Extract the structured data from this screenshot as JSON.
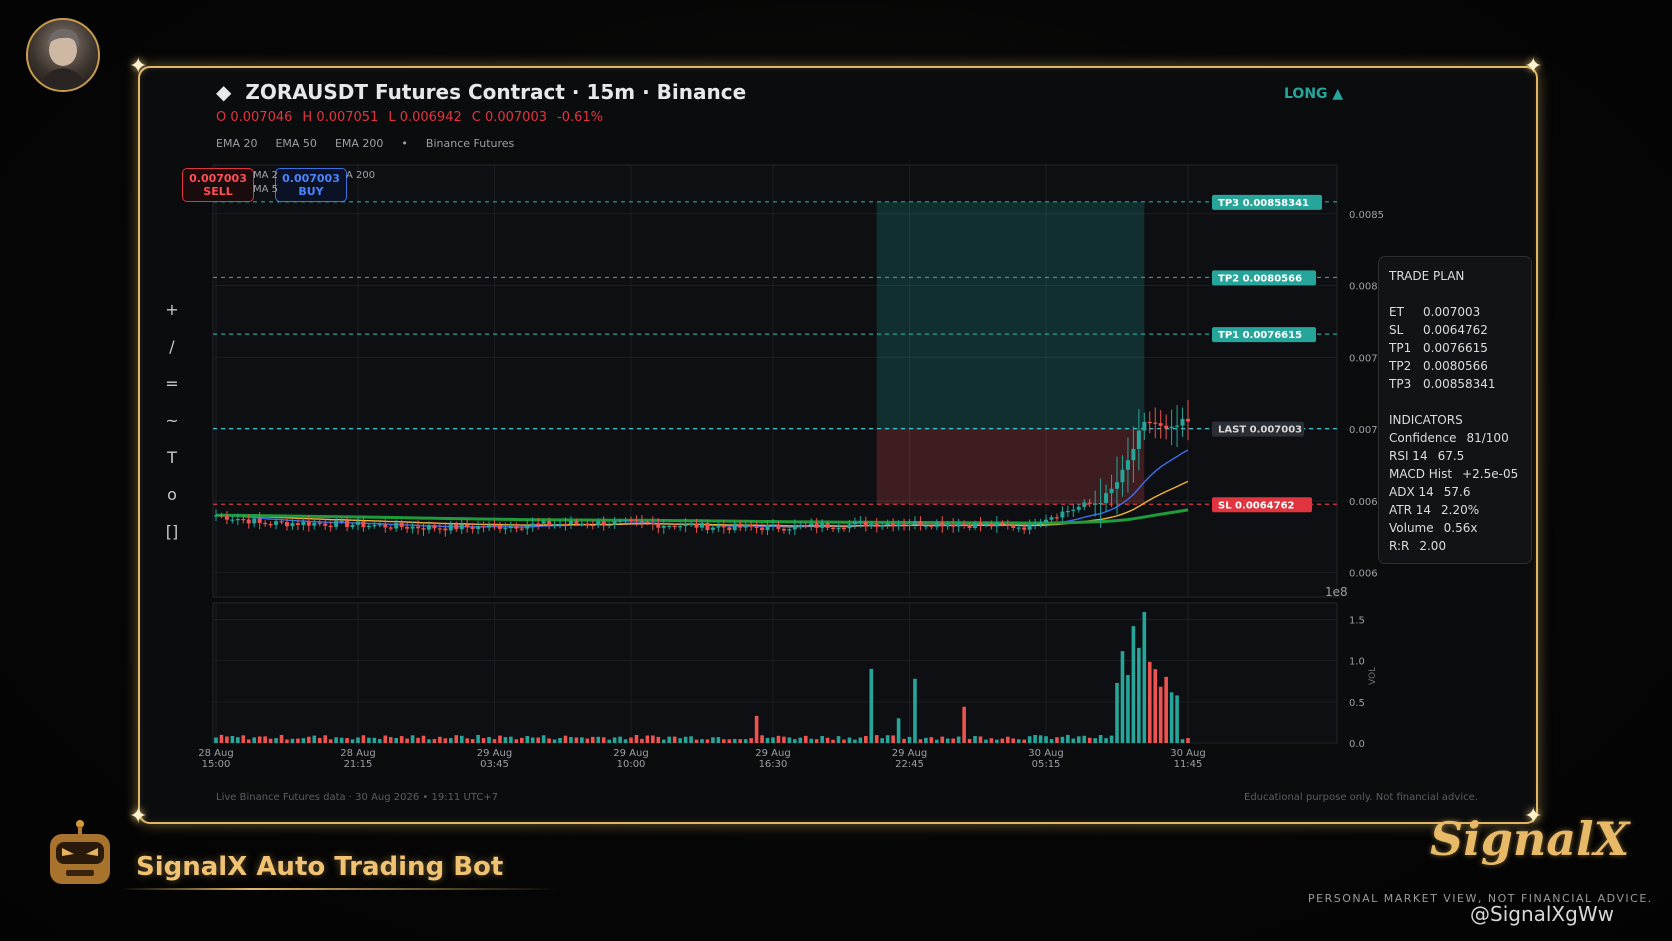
{
  "header": {
    "title": "ZORAUSDT Futures Contract · 15m · Binance",
    "diamond": "◆",
    "ohlc": {
      "o": "O 0.007046",
      "h": "H 0.007051",
      "l": "L 0.006942",
      "c": "C 0.007003",
      "chg": "-0.61%"
    },
    "legend": [
      "EMA 20",
      "EMA 50",
      "EMA 200",
      "•",
      "Binance Futures"
    ],
    "direction": "LONG ▲"
  },
  "toolbar": {
    "tools": [
      "+",
      "/",
      "=",
      "~",
      "T",
      "o",
      "[]"
    ]
  },
  "order_buttons": {
    "sell": {
      "price": "0.007003",
      "label": "SELL"
    },
    "buy": {
      "price": "0.007003",
      "label": "BUY"
    },
    "hidden_legend": [
      "MA 2",
      "A 200",
      "MA 5"
    ]
  },
  "levels": {
    "tp3": "TP3  0.00858341",
    "tp2": "TP2  0.0080566",
    "tp1": "TP1  0.0076615",
    "last": "LAST  0.007003",
    "sl": "SL  0.0064762"
  },
  "trade_plan": {
    "title": "TRADE PLAN",
    "rows": [
      {
        "k": "ET",
        "v": "0.007003"
      },
      {
        "k": "SL",
        "v": "0.0064762"
      },
      {
        "k": "TP1",
        "v": "0.0076615"
      },
      {
        "k": "TP2",
        "v": "0.0080566"
      },
      {
        "k": "TP3",
        "v": "0.00858341"
      }
    ],
    "ind_title": "INDICATORS",
    "indicators": [
      {
        "k": "Confidence",
        "v": "81/100"
      },
      {
        "k": "RSI 14",
        "v": "67.5"
      },
      {
        "k": "MACD Hist",
        "v": "+2.5e-05"
      },
      {
        "k": "ADX 14",
        "v": "57.6"
      },
      {
        "k": "ATR 14",
        "v": "2.20%"
      },
      {
        "k": "Volume",
        "v": "0.56x"
      },
      {
        "k": "R:R",
        "v": "2.00"
      }
    ]
  },
  "chart_data": {
    "type": "candlestick",
    "y_ticks": [
      "0.0085",
      "0.008",
      "0.007",
      "0.007",
      "0.006",
      "0.006"
    ],
    "y_tick_values": [
      0.0085,
      0.008,
      0.0075,
      0.007,
      0.0065,
      0.006
    ],
    "ylim": [
      0.00583,
      0.00884
    ],
    "vol_ticks": [
      "1.5",
      "1.0",
      "0.5",
      "0.0"
    ],
    "vol_tick_values": [
      1.5,
      1.0,
      0.5,
      0.0
    ],
    "vol_ylim": [
      0,
      1.7
    ],
    "vol_label": "VOL",
    "vol_exponent": "1e8",
    "x_ticks": [
      {
        "i": 0,
        "d": "28 Aug",
        "t": "15:00"
      },
      {
        "i": 26,
        "d": "28 Aug",
        "t": "21:15"
      },
      {
        "i": 51,
        "d": "29 Aug",
        "t": "03:45"
      },
      {
        "i": 76,
        "d": "29 Aug",
        "t": "10:00"
      },
      {
        "i": 102,
        "d": "29 Aug",
        "t": "16:30"
      },
      {
        "i": 127,
        "d": "29 Aug",
        "t": "22:45"
      },
      {
        "i": 152,
        "d": "30 Aug",
        "t": "05:15"
      },
      {
        "i": 178,
        "d": "30 Aug",
        "t": "11:45"
      }
    ],
    "n_candles": 179,
    "entry": 0.007003,
    "stop_loss": 0.0064762,
    "take_profit": [
      0.0076615,
      0.0080566,
      0.00858341
    ],
    "last": 0.007003,
    "zone_start_index": 121,
    "zone_end_index": 170,
    "colors": {
      "up": "#26a69a",
      "down": "#ef5350",
      "ema20": "#3f6df0",
      "ema50": "#f2b33a",
      "ema200": "#1e9b3a",
      "tp": "#26a69a",
      "sl": "#e0343f",
      "last": "#3bc6d4"
    }
  },
  "footer": {
    "left": "Live Binance Futures data  ·  30 Aug 2026 • 19:11 UTC+7",
    "right": "Educational purpose only. Not financial advice."
  },
  "brand": {
    "name": "SignalX Auto Trading Bot",
    "logo": "SignalX",
    "tagline": "PERSONAL MARKET VIEW, NOT FINANCIAL ADVICE.",
    "handle": "@SignalXgWw"
  }
}
